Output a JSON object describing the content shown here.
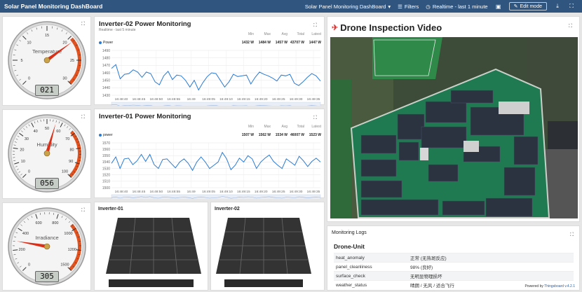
{
  "header": {
    "title": "Solar Panel Monitoring DashBoard",
    "dashboard_select": "Solar Panel Monitoring DashBoard",
    "filters": "Filters",
    "realtime": "Realtime - last 1 minute",
    "edit_mode": "Edit mode"
  },
  "gauges": [
    {
      "label": "Temperature",
      "value": "021",
      "min": 0,
      "max": 30,
      "reading": 21,
      "ticks": [
        "0",
        "5",
        "10",
        "15",
        "20",
        "25",
        "30"
      ]
    },
    {
      "label": "Humidity",
      "value": "056",
      "min": 0,
      "max": 100,
      "reading": 56,
      "ticks": [
        "0",
        "10",
        "20",
        "30",
        "40",
        "50",
        "60",
        "70",
        "80",
        "90",
        "100"
      ]
    },
    {
      "label": "Irradiance",
      "value": "305",
      "min": 0,
      "max": 1500,
      "reading": 305,
      "ticks": [
        "0",
        "200",
        "400",
        "600",
        "800",
        "1000",
        "1200",
        "1500"
      ]
    }
  ],
  "chart_data": [
    {
      "type": "line",
      "title": "Inverter-02 Power Monitoring",
      "subtitle": "Realtime - last 5 minute",
      "series": [
        {
          "name": "Power",
          "values": [
            1466,
            1471,
            1452,
            1458,
            1459,
            1464,
            1461,
            1454,
            1461,
            1459,
            1448,
            1444,
            1456,
            1462,
            1451,
            1457,
            1456,
            1450,
            1441,
            1450,
            1437,
            1447,
            1455,
            1460,
            1459,
            1450,
            1441,
            1448,
            1458,
            1455,
            1456,
            1457,
            1445,
            1454,
            1461,
            1458,
            1456,
            1453,
            1449,
            1457,
            1456,
            1458,
            1446,
            1443,
            1448,
            1454,
            1459,
            1456,
            1449
          ]
        }
      ],
      "stats": {
        "labels": [
          "Min",
          "Max",
          "Avg",
          "Total",
          "Latest"
        ],
        "values": [
          "1432 W",
          "1484 W",
          "1457 W",
          "43707 W",
          "1447 W"
        ]
      },
      "ylim": [
        1430,
        1490
      ],
      "yticks": [
        "1490",
        "1480",
        "1470",
        "1460",
        "1450",
        "1440",
        "1430"
      ],
      "xticks": [
        "16:48:40",
        "16:48:45",
        "16:48:50",
        "16:48:55",
        "16:49",
        "16:49:05",
        "16:49:10",
        "16:49:15",
        "16:49:20",
        "16:49:25",
        "16:49:30",
        "16:49:35"
      ]
    },
    {
      "type": "line",
      "title": "Inverter-01 Power Monitoring",
      "subtitle": "",
      "series": [
        {
          "name": "power",
          "values": [
            1538,
            1548,
            1530,
            1545,
            1546,
            1536,
            1542,
            1552,
            1541,
            1552,
            1536,
            1530,
            1544,
            1545,
            1538,
            1531,
            1540,
            1545,
            1538,
            1527,
            1540,
            1548,
            1540,
            1530,
            1535,
            1540,
            1555,
            1545,
            1528,
            1535,
            1546,
            1540,
            1550,
            1545,
            1530,
            1540,
            1546,
            1551,
            1541,
            1535,
            1530,
            1545,
            1540,
            1535,
            1549,
            1542,
            1533,
            1541,
            1546,
            1540
          ]
        }
      ],
      "stats": {
        "labels": [
          "Min",
          "Max",
          "Avg",
          "Total",
          "Latest"
        ],
        "values": [
          "1507 W",
          "1562 W",
          "1534 W",
          "46007 W",
          "1523 W"
        ]
      },
      "ylim": [
        1500,
        1570
      ],
      "yticks": [
        "1570",
        "1560",
        "1550",
        "1540",
        "1530",
        "1520",
        "1510",
        "1500"
      ],
      "xticks": [
        "16:48:40",
        "16:48:45",
        "16:48:50",
        "16:48:55",
        "16:49",
        "16:49:05",
        "16:49:10",
        "16:49:15",
        "16:49:20",
        "16:49:25",
        "16:49:30",
        "16:49:35"
      ]
    }
  ],
  "inverters": [
    {
      "label": "Inverter-01"
    },
    {
      "label": "Inverter-02"
    }
  ],
  "drone": {
    "title": "Drone Inspection Video"
  },
  "logs": {
    "title": "Monitoring Logs",
    "unit": "Drone-Unit",
    "rows": [
      {
        "key": "heat_anomaly",
        "value": "正常 (无热斑反应)"
      },
      {
        "key": "panel_cleanliness",
        "value": "98% (良好)"
      },
      {
        "key": "surface_check",
        "value": "无明显物理损坏"
      },
      {
        "key": "weather_status",
        "value": "晴朗 / 无风 / 适合飞行"
      }
    ]
  },
  "footer": {
    "prefix": "Powered by",
    "brand": "Thingsboard v.4.2.1"
  },
  "colors": {
    "header": "#305680",
    "line": "#2a7bd5",
    "gauge_red": "#e0521f"
  }
}
